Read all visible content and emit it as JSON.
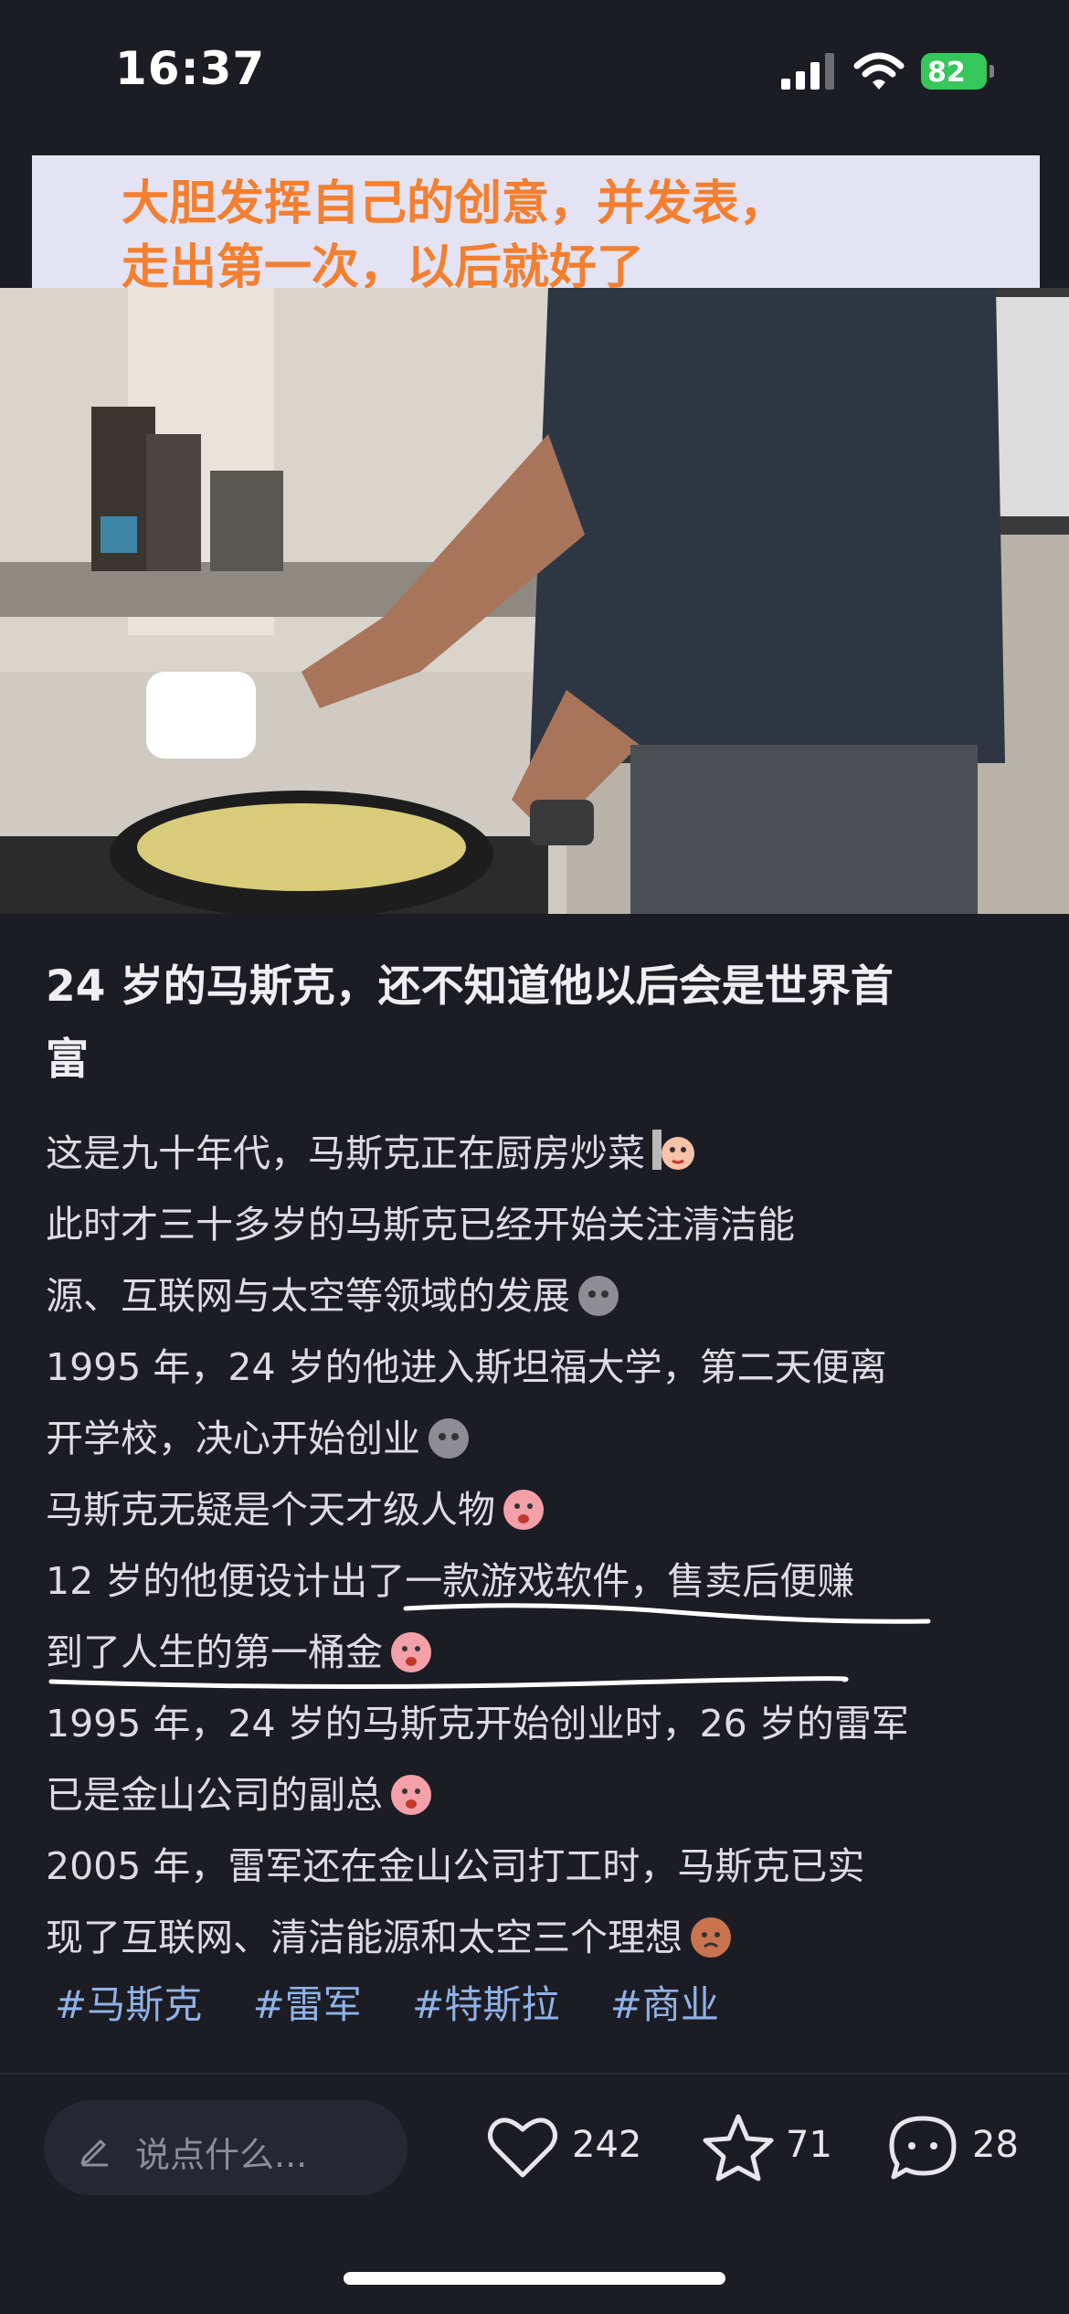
{
  "status_bar": {
    "time": "16:37",
    "battery": "82"
  },
  "media": {
    "caption_lines": [
      "大胆发挥自己的创意，并发表，",
      "走出第一次，以后就好了"
    ]
  },
  "post": {
    "title_lines": [
      "24 岁的马斯克，还不知道他以后会是世界首",
      "富"
    ],
    "body_lines": [
      "这是九十年代，马斯克正在厨房炒菜",
      "此时才三十多岁的马斯克已经开始关注清洁能",
      "源、互联网与太空等领域的发展",
      "1995 年，24 岁的他进入斯坦福大学，第二天便离",
      "开学校，决心开始创业",
      "马斯克无疑是个天才级人物",
      "12 岁的他便设计出了一款游戏软件，售卖后便赚",
      "到了人生的第一桶金",
      "1995 年，24 岁的马斯克开始创业时，26 岁的雷军",
      "已是金山公司的副总",
      "2005 年，雷军还在金山公司打工时，马斯克已实",
      "现了互联网、清洁能源和太空三个理想"
    ],
    "tags": [
      "#马斯克",
      "#雷军",
      "#特斯拉",
      "#商业"
    ]
  },
  "bottom_bar": {
    "comment_placeholder": "说点什么...",
    "likes": "242",
    "favorites": "71",
    "comments": "28"
  },
  "colors": {
    "background": "#1c1c24",
    "caption_text": "#f47f2f",
    "caption_bg": "#e3e3f3",
    "tag": "#8fb2e8",
    "battery": "#35c759"
  }
}
